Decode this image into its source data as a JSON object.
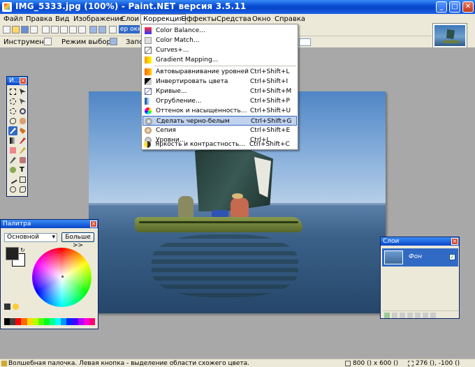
{
  "window": {
    "title": "IMG_5333.jpg (100%) - Paint.NET версия 3.5.11",
    "min": "_",
    "max": "□",
    "close": "✕"
  },
  "menu": [
    "Файл",
    "Правка",
    "Вид",
    "Изображение",
    "Слои",
    "Коррекция",
    "Эффекты",
    "Средства",
    "Окно",
    "Справка"
  ],
  "active_menu": "Коррекция",
  "toolbar": {
    "combo_value": "ер окна",
    "instrument_label": "Инструмент:",
    "mode_label": "Режим выбора:",
    "fill_label": "Запо"
  },
  "adjustments_menu": {
    "items": [
      {
        "label": "Color Balance...",
        "shortcut": ""
      },
      {
        "label": "Color Match...",
        "shortcut": ""
      },
      {
        "label": "Curves+...",
        "shortcut": ""
      },
      {
        "label": "Gradient Mapping...",
        "shortcut": ""
      },
      {
        "label": "Автовыравнивание уровней",
        "shortcut": "Ctrl+Shift+L"
      },
      {
        "label": "Инвертировать цвета",
        "shortcut": "Ctrl+Shift+I"
      },
      {
        "label": "Кривые...",
        "shortcut": "Ctrl+Shift+M"
      },
      {
        "label": "Огрубление...",
        "shortcut": "Ctrl+Shift+P"
      },
      {
        "label": "Оттенок и насыщенность...",
        "shortcut": "Ctrl+Shift+U"
      },
      {
        "label": "Сделать черно-белым",
        "shortcut": "Ctrl+Shift+G"
      },
      {
        "label": "Сепия",
        "shortcut": "Ctrl+Shift+E"
      },
      {
        "label": "Уровни...",
        "shortcut": "Ctrl+L"
      },
      {
        "label": "Яркость и контрастность...",
        "shortcut": "Ctrl+Shift+C"
      }
    ],
    "highlighted": "Сделать черно-белым"
  },
  "tools_panel": {
    "title": "И..."
  },
  "palette_panel": {
    "title": "Палитра",
    "mode_value": "Основной",
    "more_button": "Больше >>",
    "primary_color": "#222222",
    "secondary_color": "#ffffff"
  },
  "layers_panel": {
    "title": "Слои",
    "layers": [
      {
        "name": "Фон",
        "visible": true
      }
    ]
  },
  "statusbar": {
    "hint": "Волшебная палочка. Левая кнопка - выделение области схожего цвета.",
    "size": "800 () x 600 ()",
    "position": "276 (), -100 ()"
  },
  "colors": {
    "accent": "#316ac5",
    "title_blue": "#0846c8",
    "workspace": "#a8a8a8"
  }
}
